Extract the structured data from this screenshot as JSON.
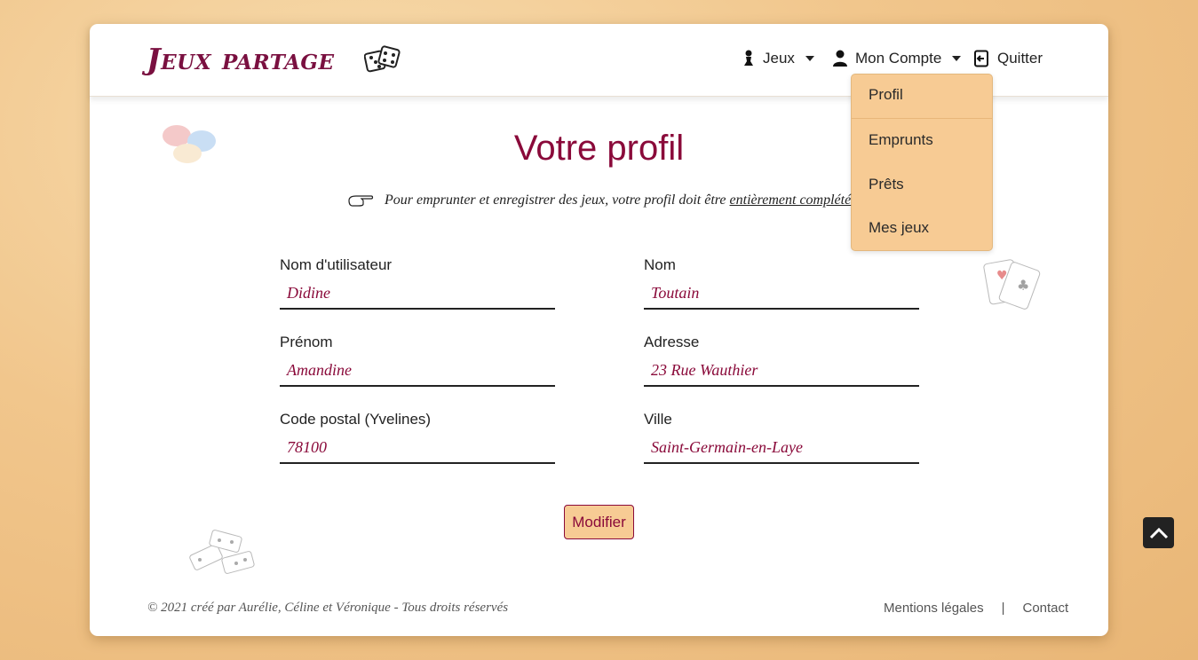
{
  "header": {
    "logo_text": "Jeux partage",
    "nav": {
      "games_label": "Jeux",
      "account_label": "Mon Compte",
      "quit_label": "Quitter"
    }
  },
  "account_menu": {
    "items": [
      "Profil",
      "Emprunts",
      "Prêts",
      "Mes jeux"
    ]
  },
  "main": {
    "title": "Votre profil",
    "notice_prefix": "Pour emprunter et enregistrer des jeux, votre profil doit être ",
    "notice_emphasis": "entièrement complété"
  },
  "form": {
    "username": {
      "label": "Nom d'utilisateur",
      "value": "Didine"
    },
    "lastname": {
      "label": "Nom",
      "value": "Toutain"
    },
    "firstname": {
      "label": "Prénom",
      "value": "Amandine"
    },
    "address": {
      "label": "Adresse",
      "value": "23 Rue Wauthier"
    },
    "postal": {
      "label": "Code postal (Yvelines)",
      "value": "78100"
    },
    "city": {
      "label": "Ville",
      "value": "Saint-Germain-en-Laye"
    },
    "submit_label": "Modifier"
  },
  "footer": {
    "copyright": "© 2021 créé par Aurélie, Céline et Véronique - Tous droits réservés",
    "legal_label": "Mentions légales",
    "separator": "|",
    "contact_label": "Contact"
  },
  "colors": {
    "accent": "#8a0a3a",
    "dropdown_bg": "#f7cb94",
    "logo": "#7a1040"
  }
}
